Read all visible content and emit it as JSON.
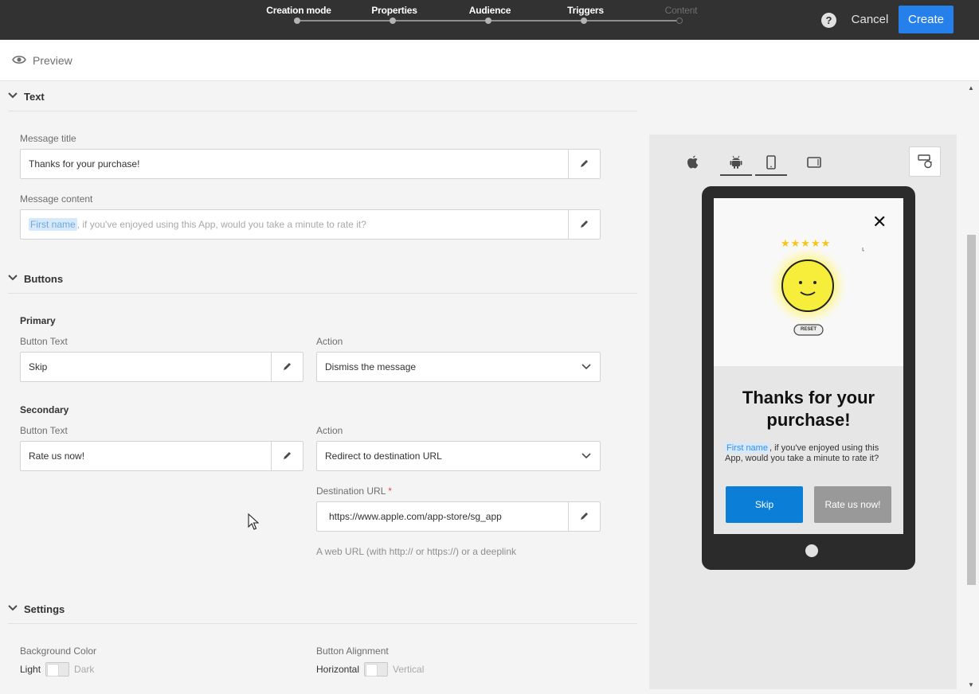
{
  "wizard": {
    "steps": [
      {
        "label": "Creation mode",
        "state": "done"
      },
      {
        "label": "Properties",
        "state": "done"
      },
      {
        "label": "Audience",
        "state": "done"
      },
      {
        "label": "Triggers",
        "state": "current"
      },
      {
        "label": "Content",
        "state": "disabled"
      }
    ],
    "help_label": "?",
    "cancel_label": "Cancel",
    "create_label": "Create"
  },
  "preview_bar": {
    "label": "Preview"
  },
  "sections": {
    "text": {
      "title": "Text",
      "message_title_label": "Message title",
      "message_title_value": "Thanks for your purchase!",
      "message_content_label": "Message content",
      "message_content_token": "First name",
      "message_content_rest": ", if you've enjoyed using this App, would you take a minute to rate it?"
    },
    "buttons": {
      "title": "Buttons",
      "primary": {
        "group_label": "Primary",
        "button_text_label": "Button Text",
        "button_text_value": "Skip",
        "action_label": "Action",
        "action_value": "Dismiss the message"
      },
      "secondary": {
        "group_label": "Secondary",
        "button_text_label": "Button Text",
        "button_text_value": "Rate us now!",
        "action_label": "Action",
        "action_value": "Redirect to destination URL",
        "url_label": "Destination URL",
        "url_required": "*",
        "url_value": "https://www.apple.com/app-store/sg_app",
        "url_helper": "A web URL (with http:// or https://) or a deeplink"
      }
    },
    "settings": {
      "title": "Settings",
      "bg_color_label": "Background Color",
      "bg_color_on": "Light",
      "bg_color_off": "Dark",
      "alignment_label": "Button Alignment",
      "alignment_on": "Horizontal",
      "alignment_off": "Vertical"
    }
  },
  "device_preview": {
    "image_badge": "RESET",
    "close_glyph": "✕",
    "title": "Thanks for your purchase!",
    "content_token": "First name",
    "content_rest": ", if you've enjoyed using this App, would you take a minute to rate it?",
    "primary_button": "Skip",
    "secondary_button": "Rate us now!",
    "stars": "★★★★★"
  },
  "colors": {
    "topbar": "#323232",
    "accent": "#2680eb",
    "preview_primary": "#0b7ed8",
    "preview_secondary": "#999999",
    "required": "#e34850"
  }
}
